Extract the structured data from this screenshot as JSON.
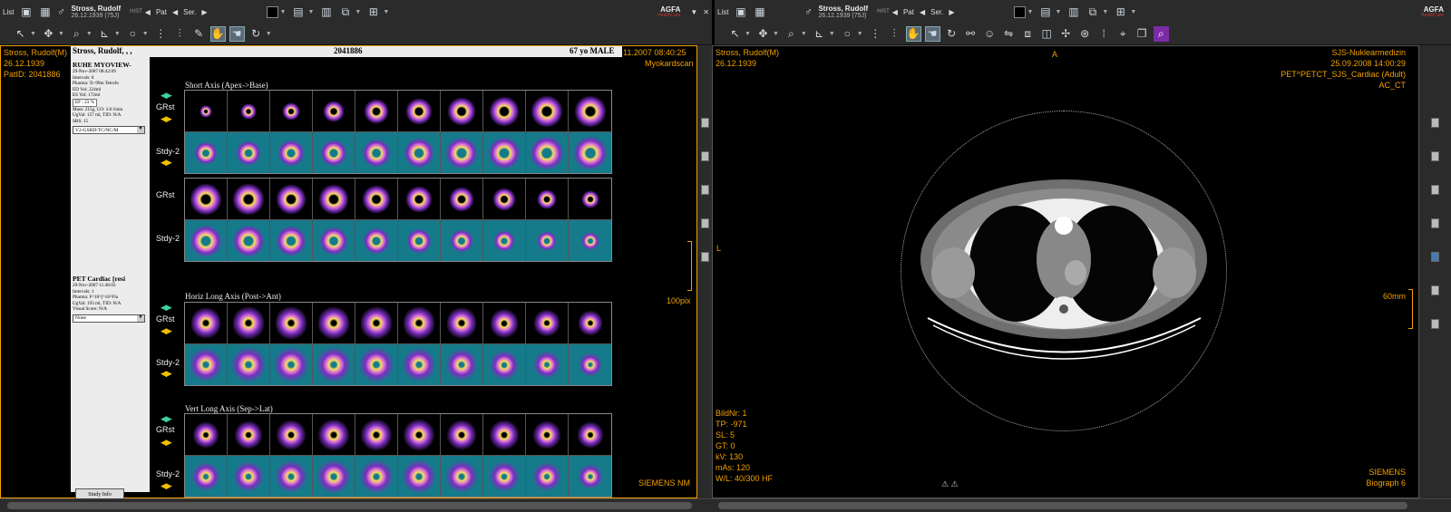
{
  "left_toolbar": {
    "list_label": "List",
    "patient_name": "Stross, Rudolf",
    "patient_dob": "26.12.1939 (75J)",
    "hist_label": "HIST",
    "pat_label": "Pat",
    "ser_label": "Ser.",
    "brand": "AGFA",
    "brand_sub": "HealthCare"
  },
  "right_toolbar": {
    "list_label": "List",
    "patient_name": "Stross, Rudolf",
    "patient_dob": "26.12.1939 (75J)",
    "hist_label": "HIST",
    "pat_label": "Pat",
    "ser_label": "Ser.",
    "brand": "AGFA",
    "brand_sub": "HealthCare"
  },
  "left_viewport": {
    "patient_name": "Stross, Rudolf(M)",
    "dob": "26.12.1939",
    "pat_id": "PatID: 2041886",
    "datetime": "11.2007 08:40:25",
    "study_type": "Myokardscan",
    "scale_label": "100pix",
    "manufacturer": "SIEMENS NM",
    "header": {
      "name": "Stross, Rudolf, , ,",
      "id": "2041886",
      "age_sex": "67 yo MALE"
    },
    "rest_info": {
      "title": "RUHE MYOVIEW-",
      "lines": [
        "29-Nov-2007 08:42:09",
        "Intervals: 8",
        "Pharma: Tc-99m Tetrofo",
        "ED Vol: 224ml",
        "ES Vol: 172ml"
      ],
      "ef": "EF : 23 %",
      "lines2": [
        "Mass: 215g, CO: 3.8 l/min",
        "UgVal: 157 ml, TID: N/A",
        "SRS: 15"
      ],
      "select": "V2-GSRD/TC/NC/M"
    },
    "pet_info": {
      "title": "PET Cardiac [resi",
      "lines": [
        "29-Nov-2007 11:48:03",
        "Intervals: 1",
        "Pharma: F^18^[^18^Flu",
        "UgVal: 193 ml, TID: N/A",
        "Visual Score: N/A"
      ],
      "select": "None"
    },
    "study_info_button": "Study Info",
    "sections": {
      "short_axis": "Short Axis (Apex->Base)",
      "horiz_long": "Horiz Long Axis (Post->Ant)",
      "vert_long": "Vert Long Axis (Sep->Lat)"
    },
    "row_labels": {
      "grst": "GRst",
      "stdy": "Stdy-2"
    }
  },
  "right_viewport": {
    "patient_name": "Stross, Rudolf(M)",
    "dob": "26.12.1939",
    "institution": "SJS-Nuklearmedizin",
    "datetime": "25.09.2008 14:00:29",
    "protocol": "PET^PETCT_SJS_Cardiac (Adult)",
    "series": "AC_CT",
    "orient_top": "A",
    "orient_left": "L",
    "scale_label": "60mm",
    "params": [
      "BildNr: 1",
      "TP: -971",
      "SL: 5",
      "GT: 0",
      "kV: 130",
      "mAs: 120",
      "W/L: 40/300 HF"
    ],
    "manufacturer": "SIEMENS",
    "model": "Biograph 6"
  },
  "colors": {
    "overlay": "#f0a000",
    "toolbar": "#2b2b2b",
    "stress_bg": "#157a8a"
  }
}
